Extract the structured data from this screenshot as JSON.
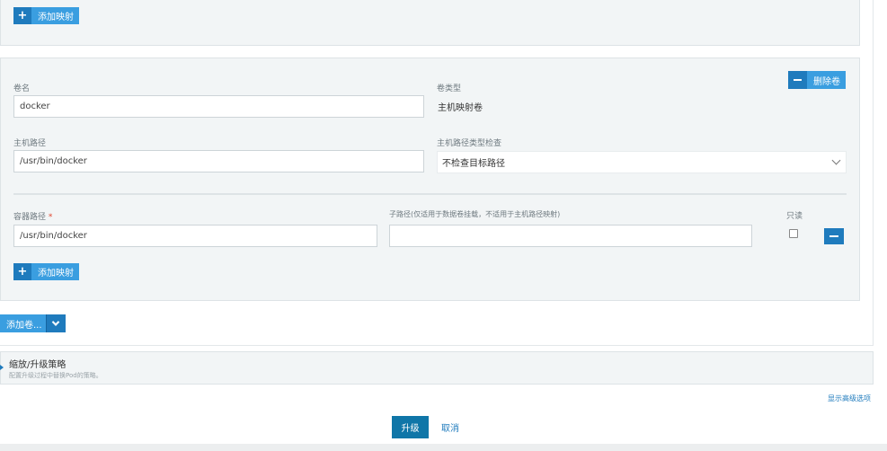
{
  "top_panel": {
    "add_mapping_label": "添加映射"
  },
  "volume": {
    "name_label": "卷名",
    "name_value": "docker",
    "type_label": "卷类型",
    "type_value": "主机映射卷",
    "delete_label": "删除卷",
    "host_path_label": "主机路径",
    "host_path_value": "/usr/bin/docker",
    "host_path_check_label": "主机路径类型检查",
    "host_path_check_value": "不检查目标路径",
    "container_path_label": "容器路径",
    "required_mark": "*",
    "container_path_value": "/usr/bin/docker",
    "subpath_label": "子路径(仅适用于数据卷挂载，不适用于主机路径映射)",
    "subpath_value": "",
    "readonly_label": "只读",
    "readonly_checked": false,
    "add_mapping_label": "添加映射"
  },
  "add_volume": {
    "label": "添加卷..."
  },
  "scaling": {
    "title": "缩放/升级策略",
    "description": "配置升级过程中替换Pod的策略。"
  },
  "footer": {
    "advanced_link": "显示高级选项",
    "upgrade_label": "升级",
    "cancel_label": "取消"
  },
  "colors": {
    "accent": "#3a9ee0",
    "accent_dark": "#1f7bbd",
    "primary": "#0f76a8",
    "panel_bg": "#f2f5f6"
  },
  "icons": {
    "add": "plus-icon",
    "remove": "minus-icon",
    "dropdown": "chevron-down-icon"
  }
}
